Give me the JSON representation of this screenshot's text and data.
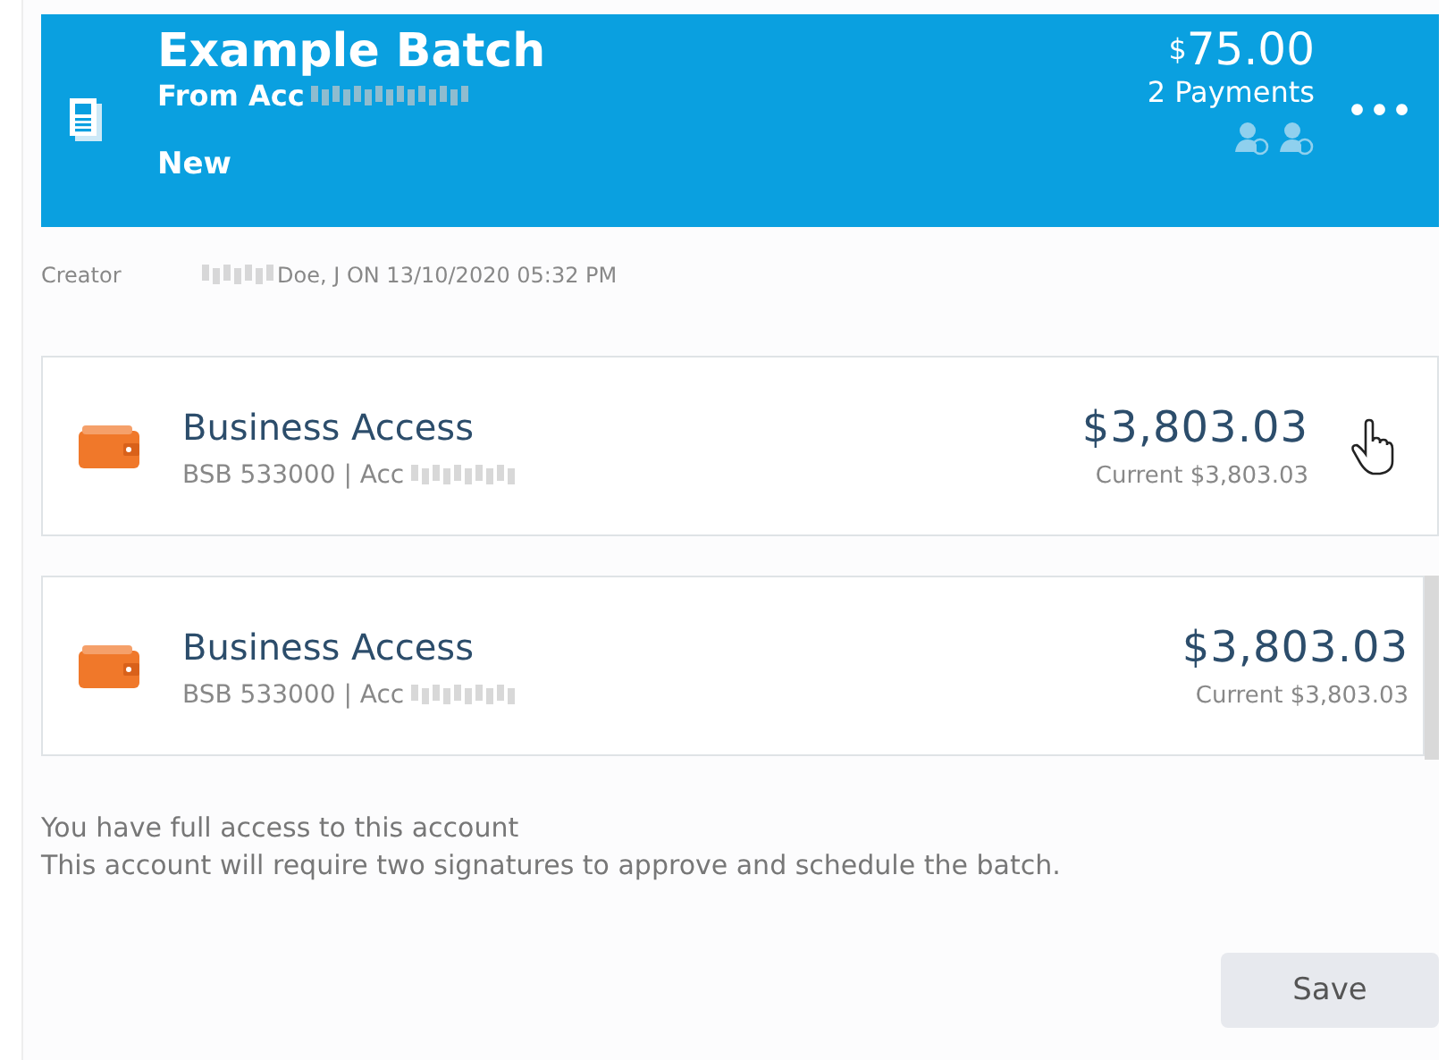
{
  "batch": {
    "title": "Example Batch",
    "from": "From Acc",
    "status": "New",
    "currency": "$",
    "amount": "75.00",
    "payments": "2 Payments",
    "menu": "•••"
  },
  "creator": {
    "label": "Creator",
    "value": "Doe, J ON 13/10/2020 05:32 PM"
  },
  "accounts": [
    {
      "name": "Business Access",
      "detail": "BSB 533000 | Acc",
      "balance": "$3,803.03",
      "current": "Current $3,803.03",
      "hovered": true
    },
    {
      "name": "Business Access",
      "detail": "BSB 533000 | Acc",
      "balance": "$3,803.03",
      "current": "Current $3,803.03",
      "hovered": false
    }
  ],
  "notes": [
    "You have full access to this account",
    "This account will require two signatures to approve and schedule the batch."
  ],
  "save_button": "Save"
}
